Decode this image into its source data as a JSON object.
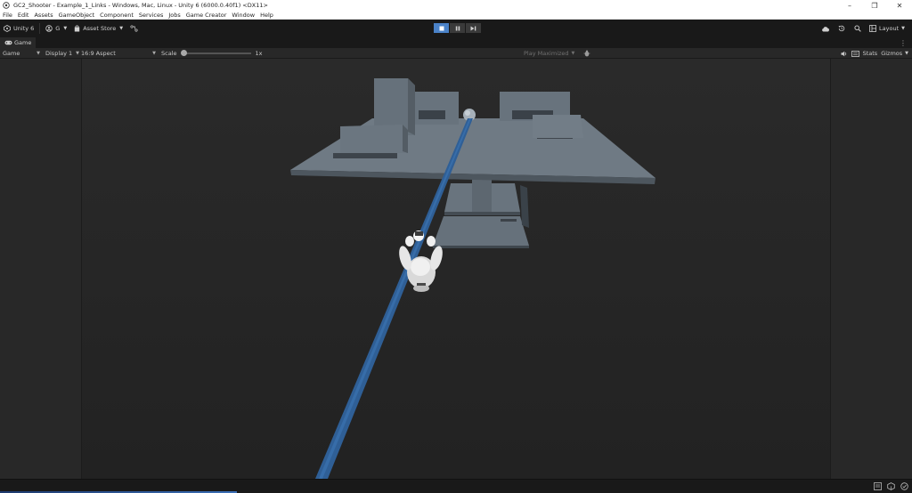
{
  "window": {
    "title": "GC2_Shooter - Example_1_Links - Windows, Mac, Linux - Unity 6 (6000.0.40f1) <DX11>",
    "controls": [
      "–",
      "❐",
      "✕"
    ]
  },
  "menu": {
    "items": [
      "File",
      "Edit",
      "Assets",
      "GameObject",
      "Component",
      "Services",
      "Jobs",
      "Game Creator",
      "Window",
      "Help"
    ]
  },
  "toolbar": {
    "unity_label": "Unity 6",
    "account_label": "G",
    "asset_store_label": "Asset Store",
    "layout_label": "Layout"
  },
  "tabs": {
    "game_label": "Game"
  },
  "gamebar": {
    "mode": "Game",
    "display": "Display 1",
    "aspect": "16:9 Aspect",
    "scale_label": "Scale",
    "scale_value": "1x",
    "play_maximized": "Play Maximized",
    "stats_label": "Stats",
    "gizmos_label": "Gizmos"
  },
  "colors": {
    "accent": "#4a82c8",
    "platform_top": "#6f7a84",
    "platform_side": "#4d565e",
    "link_line": "#2f5f96"
  },
  "status": {
    "progress": 0.26
  }
}
